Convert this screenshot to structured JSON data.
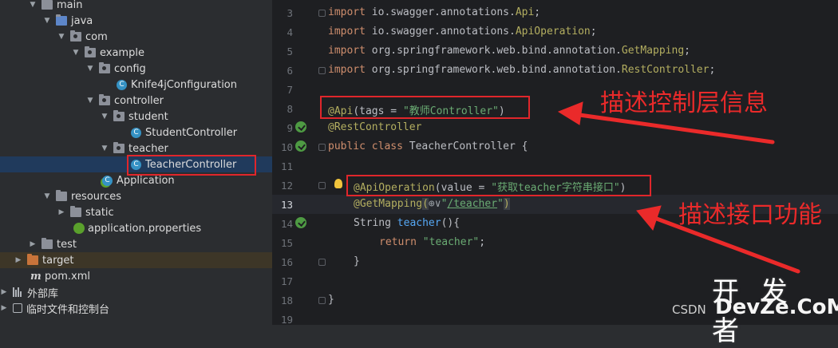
{
  "project_tree": {
    "items": [
      {
        "label": "main",
        "icon": "folder-icon"
      },
      {
        "label": "java",
        "icon": "folder-icon"
      },
      {
        "label": "com",
        "icon": "package-icon"
      },
      {
        "label": "example",
        "icon": "package-icon"
      },
      {
        "label": "config",
        "icon": "package-icon"
      },
      {
        "label": "Knife4jConfiguration",
        "icon": "class-icon"
      },
      {
        "label": "controller",
        "icon": "package-icon"
      },
      {
        "label": "student",
        "icon": "package-icon"
      },
      {
        "label": "StudentController",
        "icon": "class-icon"
      },
      {
        "label": "teacher",
        "icon": "package-icon"
      },
      {
        "label": "TeacherController",
        "icon": "class-icon",
        "selected": true
      },
      {
        "label": "Application",
        "icon": "spring-app-class-icon"
      },
      {
        "label": "resources",
        "icon": "resources-folder-icon"
      },
      {
        "label": "static",
        "icon": "folder-icon"
      },
      {
        "label": "application.properties",
        "icon": "properties-file-icon"
      },
      {
        "label": "test",
        "icon": "folder-icon"
      },
      {
        "label": "target",
        "icon": "excluded-folder-icon"
      },
      {
        "label": "pom.xml",
        "icon": "maven-icon"
      },
      {
        "label": "外部库",
        "icon": "libraries-icon"
      },
      {
        "label": "临时文件和控制台",
        "icon": "scratches-icon"
      }
    ]
  },
  "editor": {
    "line_numbers": [
      "3",
      "4",
      "5",
      "6",
      "7",
      "8",
      "9",
      "10",
      "11",
      "12",
      "13",
      "14",
      "15",
      "16",
      "17",
      "18",
      "19"
    ],
    "current_line": "13",
    "code": {
      "l3_kw": "import",
      "l3_pkg": " io.swagger.annotations.",
      "l3_cls": "Api",
      "l3_end": ";",
      "l4_kw": "import",
      "l4_pkg": " io.swagger.annotations.",
      "l4_cls": "ApiOperation",
      "l4_end": ";",
      "l5_kw": "import",
      "l5_pkg": " org.springframework.web.bind.annotation.",
      "l5_cls": "GetMapping",
      "l5_end": ";",
      "l6_kw": "import",
      "l6_pkg": " org.springframework.web.bind.annotation.",
      "l6_cls": "RestController",
      "l6_end": ";",
      "l8_ann": "@Api",
      "l8_mid": "(tags = ",
      "l8_str": "\"教师Controller\"",
      "l8_end": ")",
      "l9_ann": "@RestController",
      "l10_kw": "public class",
      "l10_rest": " TeacherController {",
      "l12_ann": "@ApiOperation",
      "l12_mid": "(value = ",
      "l12_str": "\"获取teacher字符串接口\"",
      "l12_end": ")",
      "l13_ann": "@GetMapping",
      "l13_open": "(",
      "l13_globe": "⊕∨",
      "l13_q1": "\"",
      "l13_link": "/teacher",
      "l13_q2": "\"",
      "l13_close": ")",
      "l14_type": "String ",
      "l14_fn": "teacher",
      "l14_end": "(){",
      "l15_kw": "return",
      "l15_str": " \"teacher\"",
      "l15_end": ";",
      "l16": "}",
      "l18": "}"
    }
  },
  "annotations": {
    "controller_note": "描述控制层信息",
    "api_note": "描述接口功能"
  },
  "watermark": {
    "line1": "开 发 者",
    "csdn": "CSDN",
    "site": "DevZe.CoM"
  },
  "colors": {
    "highlight_box": "#e0262b",
    "annotation_text": "#ea2a2a",
    "selection": "#203a5c"
  }
}
